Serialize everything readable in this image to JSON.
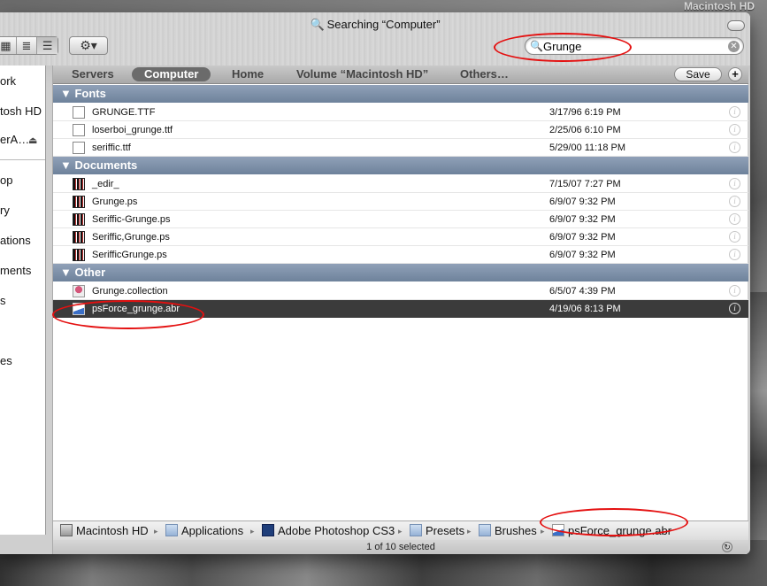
{
  "window_title": "Searching “Computer”",
  "desktop_disk": "Macintosh HD",
  "search": {
    "value": "Grunge",
    "placeholder": ""
  },
  "sidebar": [
    "ork",
    "tosh HD",
    "erA…",
    "op",
    "ry",
    "ations",
    "ments",
    "s",
    "es"
  ],
  "scopes": [
    "Servers",
    "Computer",
    "Home",
    "Volume “Macintosh HD”",
    "Others…"
  ],
  "active_scope": "Computer",
  "save_label": "Save",
  "sections": [
    {
      "title": "Fonts",
      "items": [
        {
          "name": "GRUNGE.TTF",
          "date": "3/17/96 6:19 PM"
        },
        {
          "name": "loserboi_grunge.ttf",
          "date": "2/25/06 6:10 PM"
        },
        {
          "name": "seriffic.ttf",
          "date": "5/29/00 11:18 PM"
        }
      ]
    },
    {
      "title": "Documents",
      "items": [
        {
          "name": "_edir_",
          "date": "7/15/07 7:27 PM"
        },
        {
          "name": "Grunge.ps",
          "date": "6/9/07 9:32 PM"
        },
        {
          "name": "Seriffic-Grunge.ps",
          "date": "6/9/07 9:32 PM"
        },
        {
          "name": "Seriffic,Grunge.ps",
          "date": "6/9/07 9:32 PM"
        },
        {
          "name": "SerifficGrunge.ps",
          "date": "6/9/07 9:32 PM"
        }
      ]
    },
    {
      "title": "Other",
      "items": [
        {
          "name": "Grunge.collection",
          "date": "6/5/07 4:39 PM"
        },
        {
          "name": "psForce_grunge.abr",
          "date": "4/19/06 8:13 PM",
          "selected": true
        }
      ]
    }
  ],
  "path": [
    "Macintosh HD",
    "Applications",
    "Adobe Photoshop CS3",
    "Presets",
    "Brushes",
    "psForce_grunge.abr"
  ],
  "status_text": "1 of 10 selected",
  "colors": {
    "section_header": "#7a8da6",
    "selection": "#3b3b3b",
    "annotation": "#e41010"
  }
}
